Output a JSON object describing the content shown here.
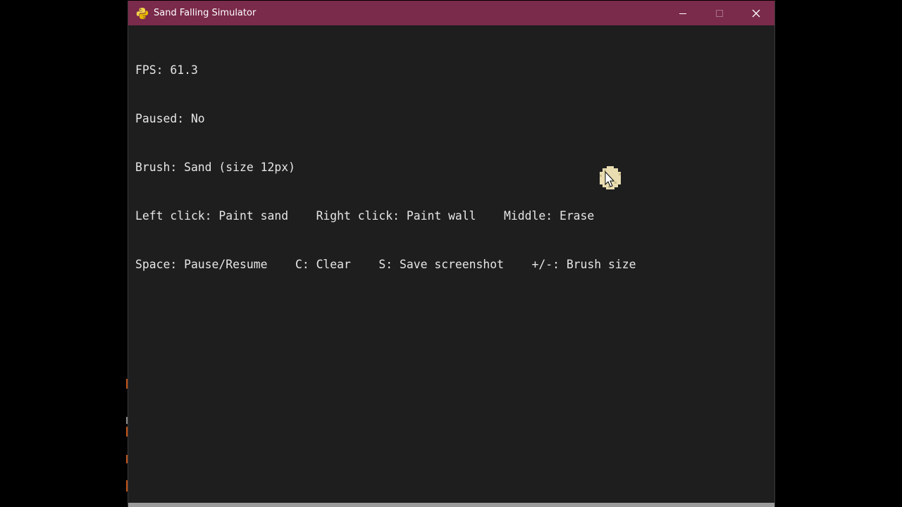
{
  "window": {
    "title": "Sand Falling Simulator",
    "app_icon": "python-icon",
    "titlebar_color": "#7a2a4a",
    "canvas_color": "#1e1e1e",
    "caption_buttons": {
      "minimize": "minimize-icon",
      "maximize": "maximize-icon",
      "close": "close-icon"
    }
  },
  "hud": {
    "fps": "FPS: 61.3",
    "paused": "Paused: No",
    "brush": "Brush: Sand (size 12px)",
    "mouse_help": "Left click: Paint sand    Right click: Paint wall    Middle: Erase",
    "key_help": "Space: Pause/Resume    C: Clear    S: Save screenshot    +/-: Brush size"
  },
  "canvas": {
    "sand_color": "#e8dcb0",
    "cursor": "arrow-cursor-icon"
  }
}
